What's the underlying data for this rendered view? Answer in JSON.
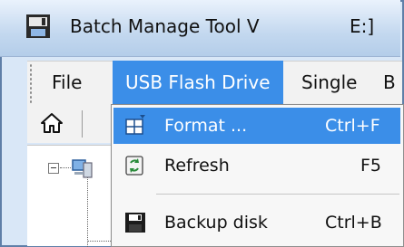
{
  "window": {
    "title": "Batch Manage Tool V",
    "path": "E:]"
  },
  "menubar": {
    "items": [
      {
        "label": "File"
      },
      {
        "label": "USB Flash Drive"
      },
      {
        "label": "Single"
      },
      {
        "label": "B"
      }
    ]
  },
  "dropdown": {
    "items": [
      {
        "label": "Format ...",
        "shortcut": "Ctrl+F",
        "icon": "format-icon",
        "highlighted": true
      },
      {
        "label": "Refresh",
        "shortcut": "F5",
        "icon": "refresh-icon",
        "highlighted": false
      },
      {
        "label": "Backup disk",
        "shortcut": "Ctrl+B",
        "icon": "floppy-disk-icon",
        "highlighted": false
      }
    ]
  },
  "colors": {
    "highlight": "#3b8ee8",
    "menu_bg": "#f2f2f2",
    "title_bg": "#c3d8ef"
  }
}
